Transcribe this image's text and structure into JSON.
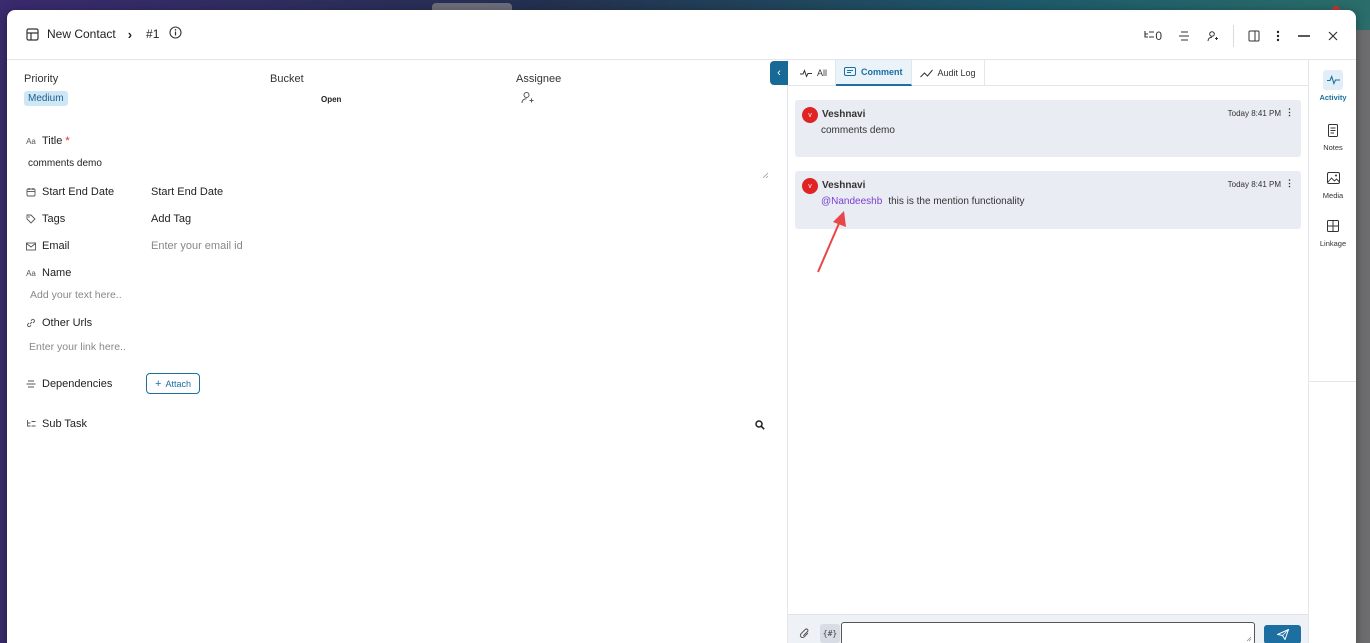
{
  "header": {
    "crumb_icon": "layout-icon",
    "title": "New Contact",
    "number": "#1",
    "counter": "0"
  },
  "fields": {
    "priority": {
      "label": "Priority",
      "value": "Medium"
    },
    "bucket": {
      "label": "Bucket",
      "value": "Open"
    },
    "assignee": {
      "label": "Assignee"
    },
    "title": {
      "label": "Title",
      "required_mark": "*",
      "value": "comments demo"
    },
    "start_end_date": {
      "label": "Start End Date",
      "value": "Start End Date"
    },
    "tags": {
      "label": "Tags",
      "value": "Add Tag"
    },
    "email": {
      "label": "Email",
      "placeholder": "Enter your email id"
    },
    "name": {
      "label": "Name",
      "placeholder": "Add your text here.."
    },
    "other_urls": {
      "label": "Other Urls",
      "placeholder": "Enter your link here.."
    },
    "dependencies": {
      "label": "Dependencies",
      "button": "Attach"
    },
    "sub_task": {
      "label": "Sub Task"
    }
  },
  "activity": {
    "tabs": [
      {
        "label": "All",
        "active": false
      },
      {
        "label": "Comment",
        "active": true
      },
      {
        "label": "Audit Log",
        "active": false
      }
    ],
    "comments": [
      {
        "author": "Veshnavi",
        "avatar_letter": "v",
        "time": "Today 8:41 PM",
        "mention": "",
        "text": "comments demo"
      },
      {
        "author": "Veshnavi",
        "avatar_letter": "v",
        "time": "Today 8:41 PM",
        "mention": "@Nandeeshb",
        "text": "this is the mention functionality"
      }
    ],
    "composer": {
      "placeholder": ""
    }
  },
  "rail": [
    {
      "label": "Activity",
      "icon": "activity-icon",
      "active": true
    },
    {
      "label": "Notes",
      "icon": "notes-icon",
      "active": false
    },
    {
      "label": "Media",
      "icon": "media-icon",
      "active": false
    },
    {
      "label": "Linkage",
      "icon": "linkage-icon",
      "active": false
    }
  ],
  "colors": {
    "accent": "#1c6fa0",
    "mention": "#7b3fd0",
    "avatar": "#e02424",
    "annotation_arrow": "#e8474a"
  }
}
